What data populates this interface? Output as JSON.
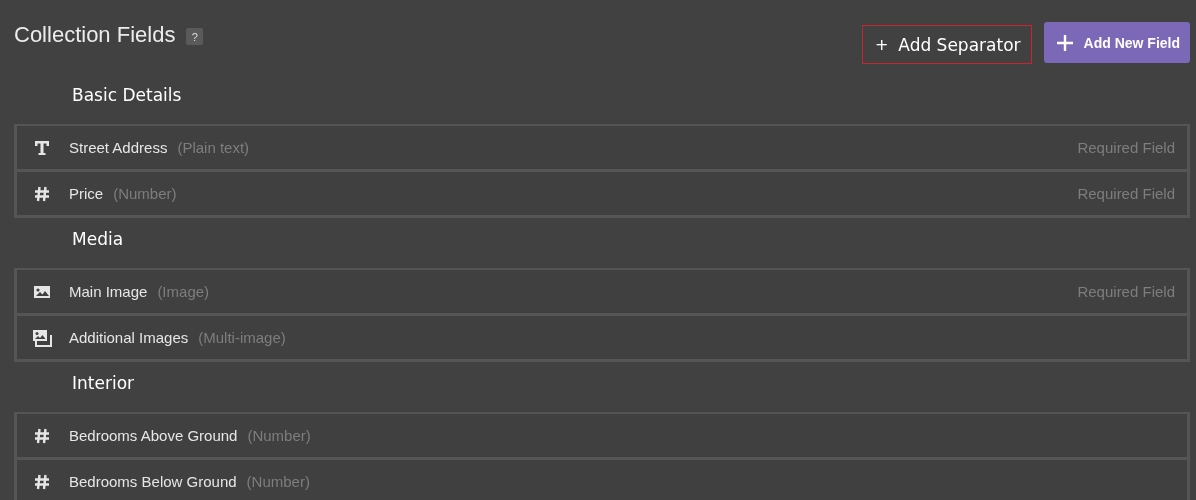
{
  "header": {
    "title": "Collection Fields",
    "help": "?"
  },
  "actions": [
    {
      "kind": "outline",
      "icon": "+",
      "label": "Add Separator"
    },
    {
      "kind": "primary",
      "label": "Add New Field"
    }
  ],
  "groups": [
    {
      "title": "Basic Details",
      "fields": [
        {
          "kind": "text",
          "name": "Street Address",
          "type": "(Plain text)",
          "note": "Required Field"
        },
        {
          "kind": "number",
          "name": "Price",
          "type": "(Number)",
          "note": "Required Field"
        }
      ]
    },
    {
      "title": "Media",
      "fields": [
        {
          "kind": "image",
          "name": "Main Image",
          "type": "(Image)",
          "note": "Required Field"
        },
        {
          "kind": "multi-image",
          "name": "Additional Images",
          "type": "(Multi-image)"
        }
      ]
    },
    {
      "title": "Interior",
      "fields": [
        {
          "kind": "number",
          "name": "Bedrooms Above Ground",
          "type": "(Number)"
        },
        {
          "kind": "number",
          "name": "Bedrooms Below Ground",
          "type": "(Number)"
        }
      ]
    }
  ]
}
